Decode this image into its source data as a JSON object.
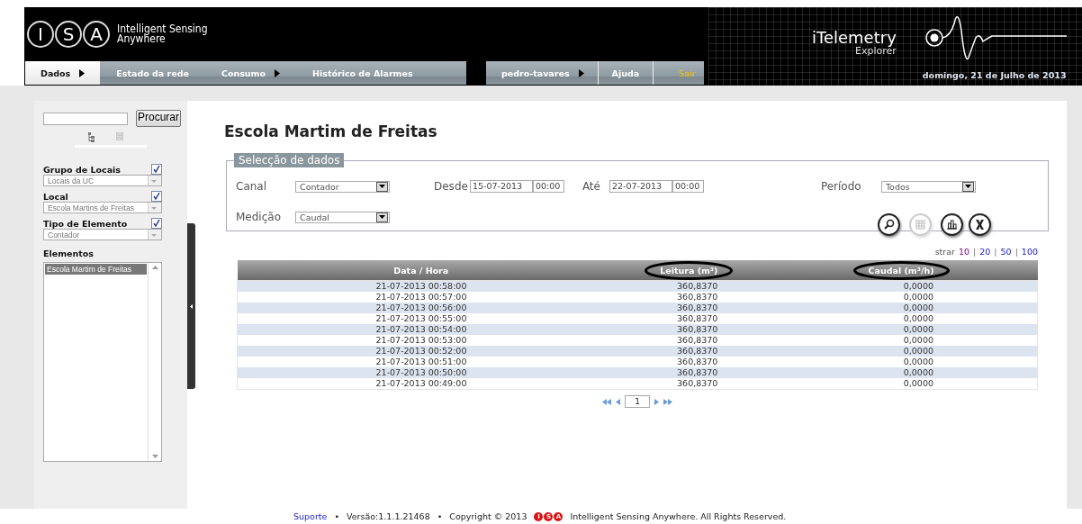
{
  "header": {
    "logo_letters": [
      "I",
      "S",
      "A"
    ],
    "company": [
      "Intelligent Sensing",
      "Anywhere"
    ],
    "product": "iTelemetry",
    "product_sub": "Explorer",
    "date": "domingo, 21 de Julho de 2013"
  },
  "nav": {
    "items": [
      {
        "label": "Dados",
        "selected": true,
        "submenu": true
      },
      {
        "label": "Estado da rede",
        "selected": false,
        "submenu": false
      },
      {
        "label": "Consumo",
        "selected": false,
        "submenu": true
      },
      {
        "label": "Histórico de Alarmes",
        "selected": false,
        "submenu": false
      }
    ],
    "user_items": [
      {
        "kind": "user",
        "label": "pedro-tavares",
        "submenu": true
      },
      {
        "kind": "link",
        "label": "Ajuda",
        "submenu": false
      },
      {
        "kind": "logout",
        "label": "Sair",
        "submenu": false
      }
    ]
  },
  "sidebar": {
    "search_button": "Procurar",
    "filters": [
      {
        "label": "Grupo de Locais",
        "checked": true,
        "value": "Locais da UC"
      },
      {
        "label": "Local",
        "checked": true,
        "value": "Escola Martins de Freitas"
      },
      {
        "label": "Tipo de Elemento",
        "checked": true,
        "value": "Contador"
      }
    ],
    "elements_label": "Elementos",
    "elements": [
      {
        "label": "Escola Martim de Freitas",
        "selected": true
      }
    ]
  },
  "main": {
    "title": "Escola Martim de Freitas",
    "selection": {
      "legend": "Selecção de dados",
      "canal_label": "Canal",
      "canal": "Contador",
      "desde_label": "Desde",
      "desde_date": "15-07-2013",
      "desde_time": "00:00",
      "ate_label": "Até",
      "ate_date": "22-07-2013",
      "ate_time": "00:00",
      "periodo_label": "Período",
      "periodo": "Todos",
      "medicao_label": "Medição",
      "medicao": "Caudal",
      "actions": [
        {
          "kind": "search",
          "disabled": false
        },
        {
          "kind": "table",
          "disabled": true
        },
        {
          "kind": "chart",
          "disabled": false
        },
        {
          "kind": "excel",
          "disabled": false
        }
      ]
    },
    "page_size": {
      "label": "strar",
      "items": [
        {
          "kind": "option",
          "label": "10",
          "selected": true
        },
        {
          "kind": "sep",
          "label": "|"
        },
        {
          "kind": "option",
          "label": "20",
          "selected": false
        },
        {
          "kind": "sep",
          "label": "|"
        },
        {
          "kind": "option",
          "label": "50",
          "selected": false
        },
        {
          "kind": "sep",
          "label": "|"
        },
        {
          "kind": "option",
          "label": "100",
          "selected": false
        }
      ]
    },
    "table": {
      "columns": [
        "Data / Hora",
        "Leitura (m³)",
        "Caudal (m³/h)"
      ],
      "rows": [
        [
          "21-07-2013 00:58:00",
          "360,8370",
          "0,0000"
        ],
        [
          "21-07-2013 00:57:00",
          "360,8370",
          "0,0000"
        ],
        [
          "21-07-2013 00:56:00",
          "360,8370",
          "0,0000"
        ],
        [
          "21-07-2013 00:55:00",
          "360,8370",
          "0,0000"
        ],
        [
          "21-07-2013 00:54:00",
          "360,8370",
          "0,0000"
        ],
        [
          "21-07-2013 00:53:00",
          "360,8370",
          "0,0000"
        ],
        [
          "21-07-2013 00:52:00",
          "360,8370",
          "0,0000"
        ],
        [
          "21-07-2013 00:51:00",
          "360,8370",
          "0,0000"
        ],
        [
          "21-07-2013 00:50:00",
          "360,8370",
          "0,0000"
        ],
        [
          "21-07-2013 00:49:00",
          "360,8370",
          "0,0000"
        ]
      ]
    },
    "pagination": {
      "page": "1"
    }
  },
  "footer": {
    "items": [
      {
        "kind": "link",
        "text": "Suporte"
      },
      {
        "kind": "sep",
        "text": "•"
      },
      {
        "kind": "text",
        "text": "Versão:1.1.1.21468"
      },
      {
        "kind": "sep",
        "text": "•"
      },
      {
        "kind": "text",
        "text": "Copyright © 2013"
      },
      {
        "kind": "logo",
        "letters": [
          "I",
          "S",
          "A"
        ]
      },
      {
        "kind": "text",
        "text": "Intelligent Sensing Anywhere. All Rights Reserved."
      }
    ]
  },
  "annotations": [
    {
      "kind": "ellipse"
    },
    {
      "kind": "ellipse"
    }
  ]
}
